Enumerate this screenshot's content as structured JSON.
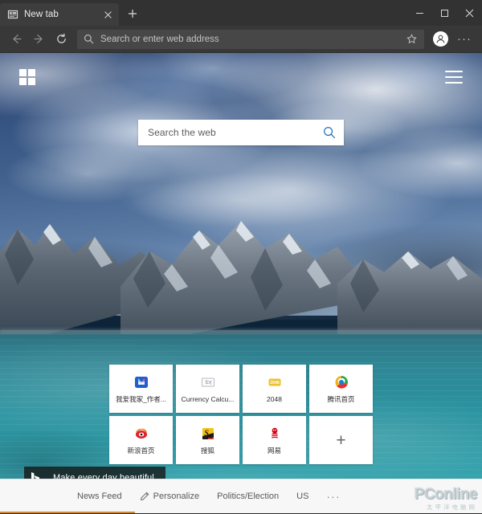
{
  "browser": {
    "tab": {
      "title": "New tab",
      "favicon_icon": "newtab-page-icon",
      "close_icon": "close-icon"
    },
    "new_tab_button": {
      "label": "+",
      "icon": "plus-icon"
    },
    "window_controls": {
      "minimize_icon": "minimize-icon",
      "maximize_icon": "maximize-icon",
      "close_icon": "close-icon"
    },
    "toolbar": {
      "back_icon": "arrow-left-icon",
      "forward_icon": "arrow-right-icon",
      "refresh_icon": "refresh-icon",
      "address_placeholder": "Search or enter web address",
      "address_value": "",
      "address_search_icon": "search-icon",
      "favorite_icon": "star-icon",
      "profile_icon": "person-icon",
      "settings_more_icon": "ellipsis-icon",
      "settings_more_label": "···"
    }
  },
  "newtab": {
    "windows_logo_icon": "windows-logo-icon",
    "menu_icon": "hamburger-menu-icon",
    "search": {
      "placeholder": "Search the web",
      "value": "",
      "icon": "search-icon"
    },
    "tiles": [
      {
        "label": "我爱我家_作者...",
        "icon": "woaiwojia-book-icon"
      },
      {
        "label": "Currency Calcu...",
        "icon": "currency-calculator-icon"
      },
      {
        "label": "2048",
        "icon": "game-2048-icon"
      },
      {
        "label": "腾讯首页",
        "icon": "tencent-icon"
      },
      {
        "label": "新浪首页",
        "icon": "sina-weibo-icon"
      },
      {
        "label": "搜狐",
        "icon": "sohu-icon"
      },
      {
        "label": "网易",
        "icon": "netease-icon"
      }
    ],
    "add_tile": {
      "label": "+",
      "icon": "plus-icon"
    },
    "bing_badge": {
      "text": "Make every day beautiful",
      "icon": "bing-logo-icon"
    },
    "news_nav": {
      "items": [
        {
          "label": "News Feed",
          "icon": ""
        },
        {
          "label": "Personalize",
          "icon": "pencil-icon"
        },
        {
          "label": "Politics/Election",
          "icon": ""
        },
        {
          "label": "US",
          "icon": ""
        }
      ],
      "more_label": "···",
      "more_icon": "ellipsis-icon"
    }
  },
  "watermark": {
    "main": "PConline",
    "sub": "太平洋电脑网"
  },
  "colors": {
    "titlebar_bg": "#323232",
    "toolbar_bg": "#383838",
    "tab_active_bg": "#3d3d3d",
    "tile_bg": "#ffffff",
    "newsbar_bg": "#f7f7f7",
    "search_accent": "#1668b8",
    "accent_strip": "#d0883a"
  }
}
